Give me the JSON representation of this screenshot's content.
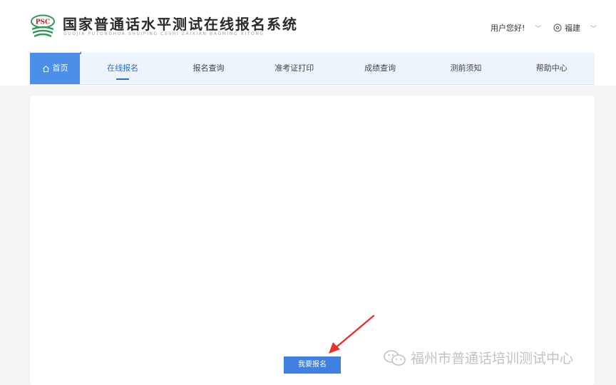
{
  "header": {
    "logo_text": "PSC",
    "title": "国家普通话水平测试在线报名系统",
    "subtitle": "GUOJIA PUTONGHUA SHUIPING CESHI ZAIXIAN BAOMING XITONG",
    "greeting": "用户您好!",
    "region": "福建"
  },
  "nav": {
    "items": [
      "首页",
      "在线报名",
      "报名查询",
      "准考证打印",
      "成绩查询",
      "测前须知",
      "帮助中心"
    ],
    "active_index": 1
  },
  "main": {
    "register_button": "我要报名"
  },
  "watermark": {
    "text": "福州市普通话培训测试中心"
  },
  "colors": {
    "accent": "#3f7fe3",
    "nav_bg": "#eef4fb",
    "arrow": "#e8322a"
  }
}
